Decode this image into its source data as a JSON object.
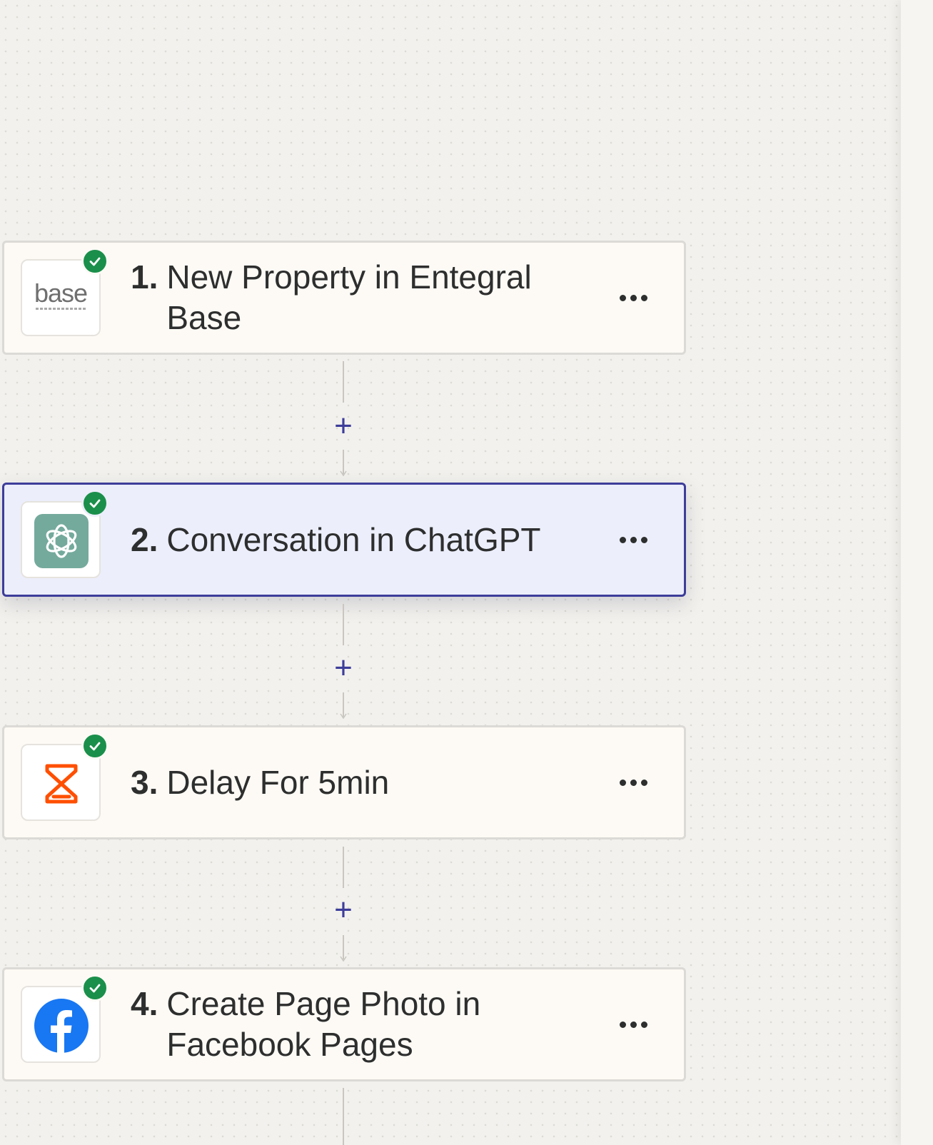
{
  "workflow": {
    "steps": [
      {
        "number": "1.",
        "title": "New Property in Entegral Base",
        "app_icon": "base-logo",
        "icon_text": "base",
        "status": "complete",
        "selected": false
      },
      {
        "number": "2.",
        "title": "Conversation in ChatGPT",
        "app_icon": "chatgpt-icon",
        "status": "complete",
        "selected": true
      },
      {
        "number": "3.",
        "title": "Delay For 5min",
        "app_icon": "hourglass-icon",
        "status": "complete",
        "selected": false
      },
      {
        "number": "4.",
        "title": "Create Page Photo in Facebook Pages",
        "app_icon": "facebook-icon",
        "status": "complete",
        "selected": false
      }
    ],
    "add_step_symbol": "+"
  },
  "colors": {
    "canvas_bg": "#f2f1ed",
    "card_bg": "#fdfaf5",
    "selected_card_bg": "#eceefb",
    "selected_border": "#3d3d9a",
    "check_green": "#1a8f4b",
    "chatgpt_green": "#74aa9c",
    "delay_orange": "#ff4f00",
    "facebook_blue": "#1877f2",
    "plus_color": "#3d3d9a"
  }
}
